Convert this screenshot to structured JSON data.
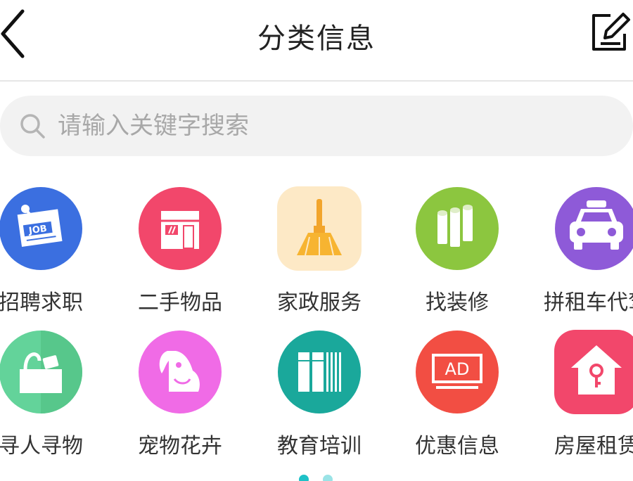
{
  "header": {
    "title": "分类信息",
    "back_icon": "chevron-left-icon",
    "edit_icon": "edit-icon"
  },
  "search": {
    "placeholder": "请输入关键字搜索",
    "icon": "search-icon"
  },
  "categories": [
    {
      "label": "招聘求职",
      "icon": "job-icon",
      "color": "#3b6fe0"
    },
    {
      "label": "二手物品",
      "icon": "shop-icon",
      "color": "#f2476b"
    },
    {
      "label": "家政服务",
      "icon": "broom-icon",
      "color": "#fde9c6"
    },
    {
      "label": "找装修",
      "icon": "rolls-icon",
      "color": "#8cc63f"
    },
    {
      "label": "拼租车代驾",
      "icon": "car-icon",
      "color": "#8e5ad8"
    },
    {
      "label": "寻人寻物",
      "icon": "box-icon",
      "color": "#63d39a"
    },
    {
      "label": "宠物花卉",
      "icon": "dog-icon",
      "color": "#f06be6"
    },
    {
      "label": "教育培训",
      "icon": "books-icon",
      "color": "#1aa89b"
    },
    {
      "label": "优惠信息",
      "icon": "ad-icon",
      "color": "#f24e43"
    },
    {
      "label": "房屋租赁",
      "icon": "house-icon",
      "color": "#f2476b"
    }
  ],
  "pager": {
    "pages": 2,
    "current": 1,
    "accent": "#1ec1c7"
  }
}
